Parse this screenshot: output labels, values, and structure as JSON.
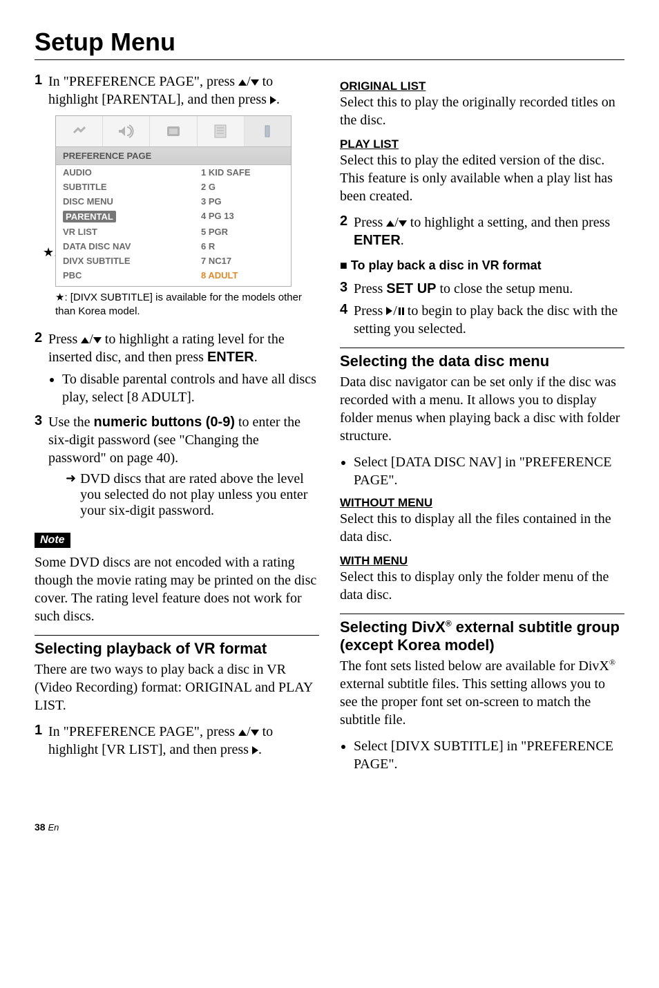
{
  "page_title": "Setup Menu",
  "left": {
    "step1": "In \"PREFERENCE PAGE\", press ▲/▼ to highlight [PARENTAL], and then press ▶.",
    "menu": {
      "header": "PREFERENCE PAGE",
      "rows": [
        {
          "k": "AUDIO",
          "v": "1 KID SAFE"
        },
        {
          "k": "SUBTITLE",
          "v": "2 G"
        },
        {
          "k": "DISC MENU",
          "v": "3 PG"
        },
        {
          "k": "PARENTAL",
          "v": "4 PG 13",
          "hilite": true
        },
        {
          "k": "VR LIST",
          "v": "5 PGR"
        },
        {
          "k": "DATA DISC NAV",
          "v": "6 R"
        },
        {
          "k": "DIVX SUBTITLE",
          "v": "7 NC17",
          "star": true
        },
        {
          "k": "PBC",
          "v": "8 ADULT",
          "orange": true
        }
      ]
    },
    "star_note": "★: [DIVX SUBTITLE] is available for the models other than Korea model.",
    "step2_a": "Press ▲/▼ to highlight a rating level for the inserted disc, and then press ",
    "step2_enter": "ENTER",
    "step2_bullet": "To disable parental controls and have all discs play, select [8 ADULT].",
    "step3_a": "Use the ",
    "step3_bold": "numeric buttons (0-9)",
    "step3_b": " to enter the six-digit password (see \"Changing the password\" on page 40).",
    "step3_arrow": "DVD discs that are rated above the level you selected do not play unless you enter your six-digit password.",
    "note_label": "Note",
    "note_body": "Some DVD discs are not encoded with a rating though the movie rating may be printed on the disc cover. The rating level feature does not work for such discs.",
    "sub_vr_title": "Selecting playback of VR format",
    "sub_vr_body": "There are two ways to play back a disc in VR (Video Recording) format: ORIGINAL and PLAY LIST.",
    "sub_vr_step1": "In \"PREFERENCE PAGE\", press ▲/▼ to highlight [VR LIST], and then press ▶."
  },
  "right": {
    "orig_head": "ORIGINAL LIST",
    "orig_body": "Select this to play the originally recorded titles on the disc.",
    "play_head": "PLAY LIST",
    "play_body": "Select this to play the edited version of the disc. This feature is only available when a play list has been created.",
    "step2_a": "Press ▲/▼ to highlight a setting, and then press ",
    "step2_enter": "ENTER",
    "square_line": "To play back a disc in VR format",
    "step3_a": "Press ",
    "step3_bold": "SET UP",
    "step3_b": " to close the setup menu.",
    "step4": "Press ▶/❙❙ to begin to play back the disc with the setting you selected.",
    "sub_data_title": "Selecting the data disc menu",
    "sub_data_body": "Data disc navigator can be set only if the disc was recorded with a menu. It allows you to display folder menus when playing back a disc with folder structure.",
    "sub_data_bullet": "Select [DATA DISC NAV] in \"PREFERENCE PAGE\".",
    "without_head": "WITHOUT MENU",
    "without_body": "Select this to display all the files contained in the data disc.",
    "with_head": "WITH MENU",
    "with_body": "Select this to display only the folder menu of the data disc.",
    "sub_divx_title_a": "Selecting DivX",
    "sub_divx_title_b": " external subtitle group (except Korea model)",
    "sub_divx_body_a": "The font sets listed below are available for DivX",
    "sub_divx_body_b": " external subtitle files. This setting allows you to see the proper font set on-screen to match the subtitle file.",
    "sub_divx_bullet": "Select [DIVX SUBTITLE] in \"PREFERENCE PAGE\"."
  },
  "footer_num": "38",
  "footer_lang": "En"
}
